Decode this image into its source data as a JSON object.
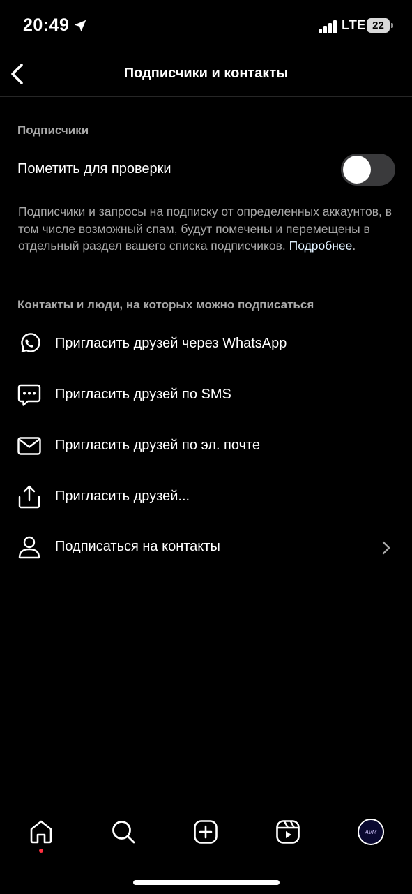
{
  "status_bar": {
    "time": "20:49",
    "network": "LTE",
    "battery": "22"
  },
  "header": {
    "title": "Подписчики и контакты"
  },
  "followers_section": {
    "title": "Подписчики",
    "toggle_label": "Пометить для проверки",
    "toggle_on": false,
    "description": "Подписчики и запросы на подписку от определенных аккаунтов, в том числе возможный спам, будут помечены и перемещены в отдельный раздел вашего списка подписчиков.",
    "link": "Подробнее",
    "link_suffix": "."
  },
  "contacts_section": {
    "title": "Контакты и люди, на которых можно подписаться",
    "items": [
      {
        "label": "Пригласить друзей через WhatsApp",
        "icon": "whatsapp-icon"
      },
      {
        "label": "Пригласить друзей по SMS",
        "icon": "sms-bubble-icon"
      },
      {
        "label": "Пригласить друзей по эл. почте",
        "icon": "mail-icon"
      },
      {
        "label": "Пригласить друзей...",
        "icon": "share-icon"
      },
      {
        "label": "Подписаться на контакты",
        "icon": "person-icon",
        "has_chevron": true
      }
    ]
  },
  "tab_bar": {
    "tabs": [
      "home-icon",
      "search-icon",
      "create-icon",
      "reels-icon",
      "profile-avatar"
    ],
    "avatar_text": "AVM",
    "notification_color": "#ff3040"
  },
  "colors": {
    "background": "#000000",
    "secondary_text": "#a8a8a8",
    "link": "#e0f1ff",
    "toggle_off": "#3a3a3c"
  }
}
